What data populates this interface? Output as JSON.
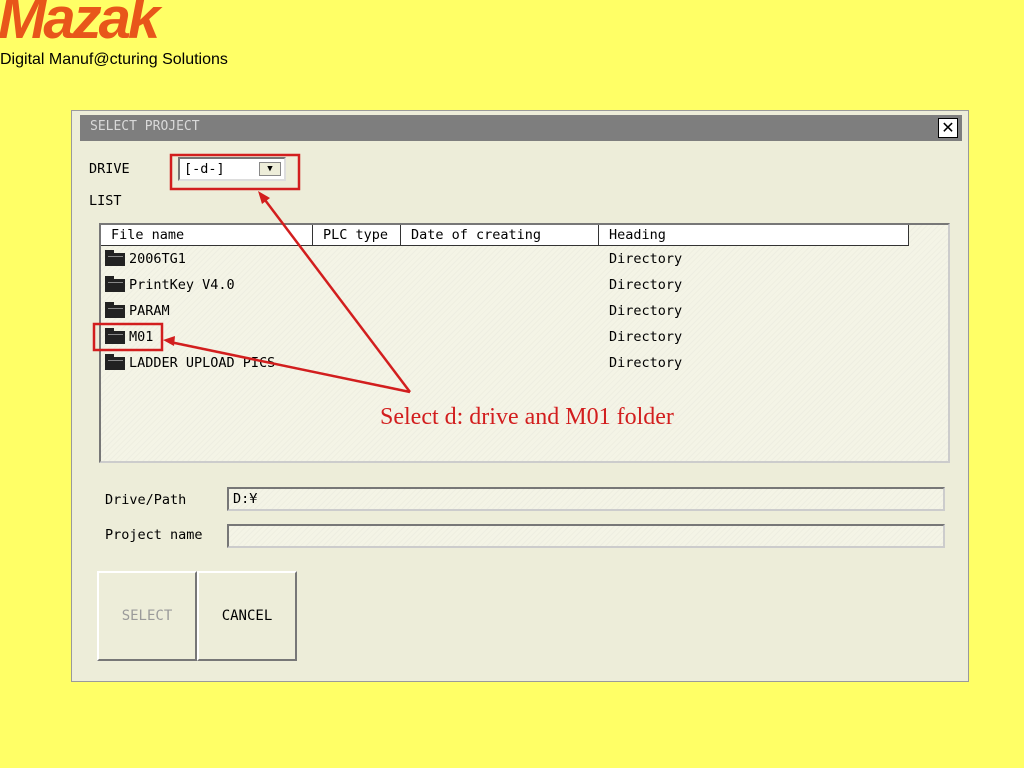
{
  "brand": {
    "logo": "Mazak",
    "tagline": "Digital Manuf@cturing Solutions",
    "logo_color": "#E8561A"
  },
  "dialog": {
    "title": "SELECT PROJECT",
    "close_icon": "close-icon",
    "drive_label": "DRIVE",
    "drive_value": "[-d-]",
    "list_label": "LIST",
    "columns": [
      "File name",
      "PLC type",
      "Date of creating",
      "Heading"
    ],
    "rows": [
      {
        "name": "2006TG1",
        "plc_type": "",
        "date": "",
        "heading": "Directory"
      },
      {
        "name": "PrintKey V4.0",
        "plc_type": "",
        "date": "",
        "heading": "Directory"
      },
      {
        "name": "PARAM",
        "plc_type": "",
        "date": "",
        "heading": "Directory"
      },
      {
        "name": "M01",
        "plc_type": "",
        "date": "",
        "heading": "Directory"
      },
      {
        "name": "LADDER UPLOAD PICS",
        "plc_type": "",
        "date": "",
        "heading": "Directory"
      }
    ],
    "drive_path_label": "Drive/Path",
    "drive_path_value": "D:¥",
    "project_name_label": "Project name",
    "project_name_value": "",
    "select_button": "SELECT",
    "cancel_button": "CANCEL"
  },
  "annotation": {
    "text": "Select d: drive and M01 folder",
    "color": "#D21E1E"
  }
}
